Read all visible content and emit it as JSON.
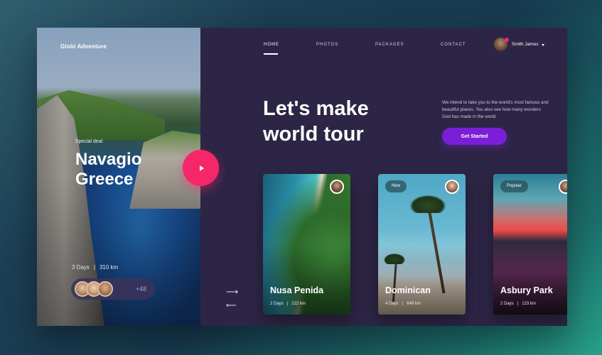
{
  "brand": "Globi Adventure",
  "nav": {
    "items": [
      "HOME",
      "PHOTOS",
      "PACKAGES",
      "CONTACT"
    ],
    "active": "HOME",
    "user_name": "Smith James"
  },
  "hero": {
    "eyebrow": "Special deal",
    "title_line1": "Navagio",
    "title_line2": "Greece",
    "days": "3 Days",
    "distance": "310 km",
    "people_more": "+48"
  },
  "headline": {
    "line1": "Let's make",
    "line2": "world tour"
  },
  "intro": "We intend to take you to the world's most famous and beautiful places. You also see how many wonders God has made in the world.",
  "cta_label": "Get Started",
  "cards": [
    {
      "title": "Nusa Penida",
      "days": "2 Days",
      "distance": "222 km",
      "badge": ""
    },
    {
      "title": "Dominican",
      "days": "4 Days",
      "distance": "648 km",
      "badge": "New"
    },
    {
      "title": "Asbury Park",
      "days": "2 Days",
      "distance": "123 km",
      "badge": "Popular"
    }
  ],
  "colors": {
    "accent_pink": "#f5266a",
    "accent_purple": "#7a1fd6",
    "panel": "#2d2545"
  },
  "icons": [
    "play-icon",
    "arrow-right-icon",
    "arrow-left-icon",
    "caret-down-icon"
  ]
}
